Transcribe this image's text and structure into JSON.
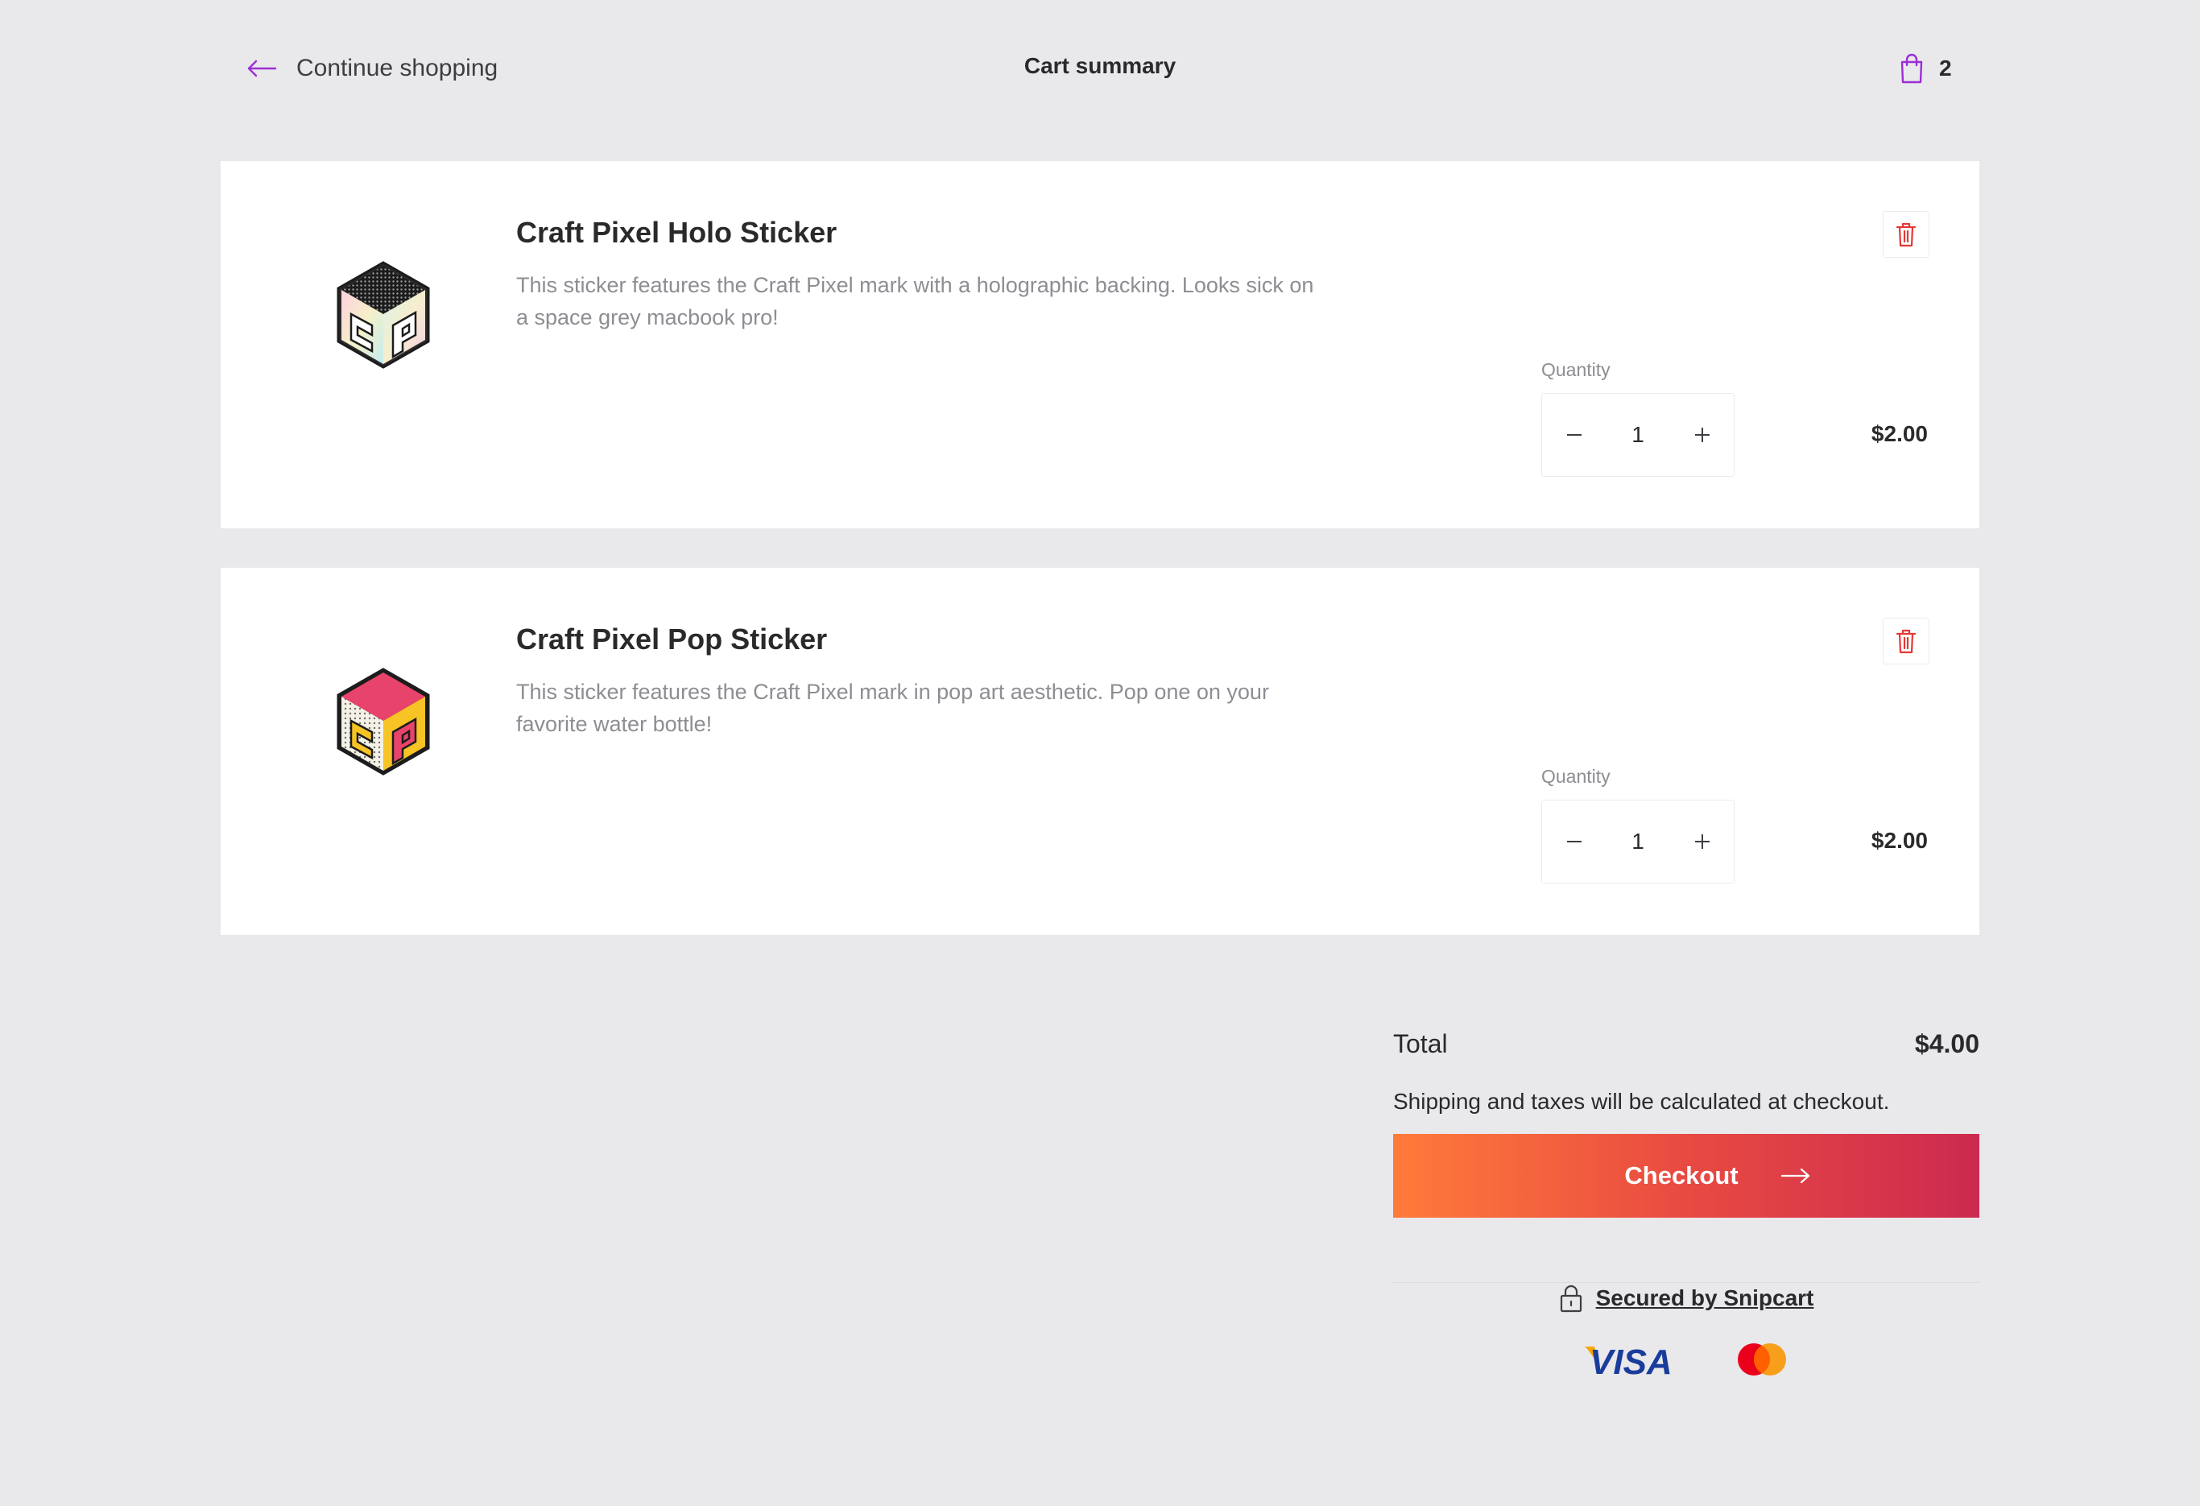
{
  "header": {
    "continue_label": "Continue shopping",
    "title": "Cart summary",
    "cart_count": "2"
  },
  "items": [
    {
      "name": "Craft Pixel Holo Sticker",
      "description": "This sticker features the Craft Pixel mark with a holographic backing. Looks sick on a space grey macbook pro!",
      "quantity_label": "Quantity",
      "quantity": "1",
      "price": "$2.00",
      "image": "holo-sticker"
    },
    {
      "name": "Craft Pixel Pop Sticker",
      "description": "This sticker features the Craft Pixel mark in pop art aesthetic. Pop one on your favorite water bottle!",
      "quantity_label": "Quantity",
      "quantity": "1",
      "price": "$2.00",
      "image": "pop-sticker"
    }
  ],
  "summary": {
    "total_label": "Total",
    "total_value": "$4.00",
    "shipping_note": "Shipping and taxes will be calculated at checkout.",
    "checkout_label": "Checkout",
    "secured_label": "Secured by Snipcart",
    "payment_methods": [
      "visa",
      "mastercard"
    ]
  },
  "colors": {
    "accent": "#9b2fd6",
    "delete": "#e53935",
    "checkout_start": "#ff7b3a",
    "checkout_end": "#cc2a4f",
    "background": "#e9e8eb"
  }
}
